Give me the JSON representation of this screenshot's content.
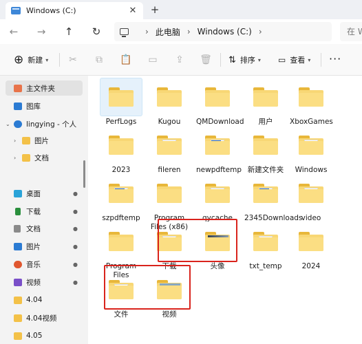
{
  "window": {
    "tab_title": "Windows (C:)",
    "close_glyph": "✕",
    "new_tab_glyph": "+"
  },
  "nav": {
    "back": "←",
    "forward": "→",
    "up": "↑",
    "refresh": "↻"
  },
  "breadcrumb": {
    "items": [
      "此电脑",
      "Windows (C:)"
    ],
    "separator": "›"
  },
  "search": {
    "placeholder": "在 W"
  },
  "toolbar": {
    "new_label": "新建",
    "sort_label": "排序",
    "view_label": "查看",
    "more_glyph": "···",
    "icons": {
      "cut": "✂",
      "copy": "⧉",
      "paste": "📋",
      "rename": "▭",
      "share": "⇪",
      "delete": "🗑"
    }
  },
  "sidebar": {
    "items": [
      {
        "label": "主文件夹",
        "icon": "home-icon",
        "color": "#e8734a"
      },
      {
        "label": "图库",
        "icon": "gallery-icon",
        "color": "#2b7bd3"
      },
      {
        "label": "lingying - 个人",
        "icon": "onedrive-icon",
        "color": "#2b7bd3"
      },
      {
        "label": "图片",
        "icon": "folder-icon",
        "color": "#f3c148"
      },
      {
        "label": "文档",
        "icon": "folder-icon",
        "color": "#f3c148"
      },
      {
        "label": "桌面",
        "icon": "desktop-icon",
        "color": "#2aa3d8"
      },
      {
        "label": "下载",
        "icon": "download-icon",
        "color": "#2a8f3d"
      },
      {
        "label": "文档",
        "icon": "document-icon",
        "color": "#8a8a8a"
      },
      {
        "label": "图片",
        "icon": "pictures-icon",
        "color": "#2b7bd3"
      },
      {
        "label": "音乐",
        "icon": "music-icon",
        "color": "#e0572f"
      },
      {
        "label": "视频",
        "icon": "video-icon",
        "color": "#7a4fc8"
      },
      {
        "label": "4.04",
        "icon": "folder-icon",
        "color": "#f3c148"
      },
      {
        "label": "4.04视频",
        "icon": "folder-icon",
        "color": "#f3c148"
      },
      {
        "label": "4.05",
        "icon": "folder-icon",
        "color": "#f3c148"
      }
    ],
    "pin_glyph": "📌",
    "expander_collapsed": "›",
    "expander_expanded": "⌄"
  },
  "files": [
    {
      "name": "PerfLogs",
      "kind": "plain"
    },
    {
      "name": "Kugou",
      "kind": "plain"
    },
    {
      "name": "QMDownload",
      "kind": "plain"
    },
    {
      "name": "用户",
      "kind": "plain"
    },
    {
      "name": "XboxGames",
      "kind": "plain"
    },
    {
      "name": "2023",
      "kind": "plain"
    },
    {
      "name": "fileren",
      "kind": "paper"
    },
    {
      "name": "newpdftemp",
      "kind": "pic"
    },
    {
      "name": "新建文件夹",
      "kind": "plain"
    },
    {
      "name": "Windows",
      "kind": "paper"
    },
    {
      "name": "szpdftemp",
      "kind": "pic"
    },
    {
      "name": "Program Files (x86)",
      "kind": "plain"
    },
    {
      "name": "qycache",
      "kind": "paper"
    },
    {
      "name": "2345Downloads",
      "kind": "pic"
    },
    {
      "name": "video",
      "kind": "paper"
    },
    {
      "name": "Program Files",
      "kind": "plain"
    },
    {
      "name": "下载",
      "kind": "paper"
    },
    {
      "name": "头像",
      "kind": "photo"
    },
    {
      "name": "txt_temp",
      "kind": "paper"
    },
    {
      "name": "2024",
      "kind": "plain"
    },
    {
      "name": "文件",
      "kind": "paper"
    },
    {
      "name": "视频",
      "kind": "video"
    }
  ],
  "colors": {
    "highlight_box": "#d9231c",
    "selection": "#e5f1fb",
    "folder": "#f8d775"
  }
}
